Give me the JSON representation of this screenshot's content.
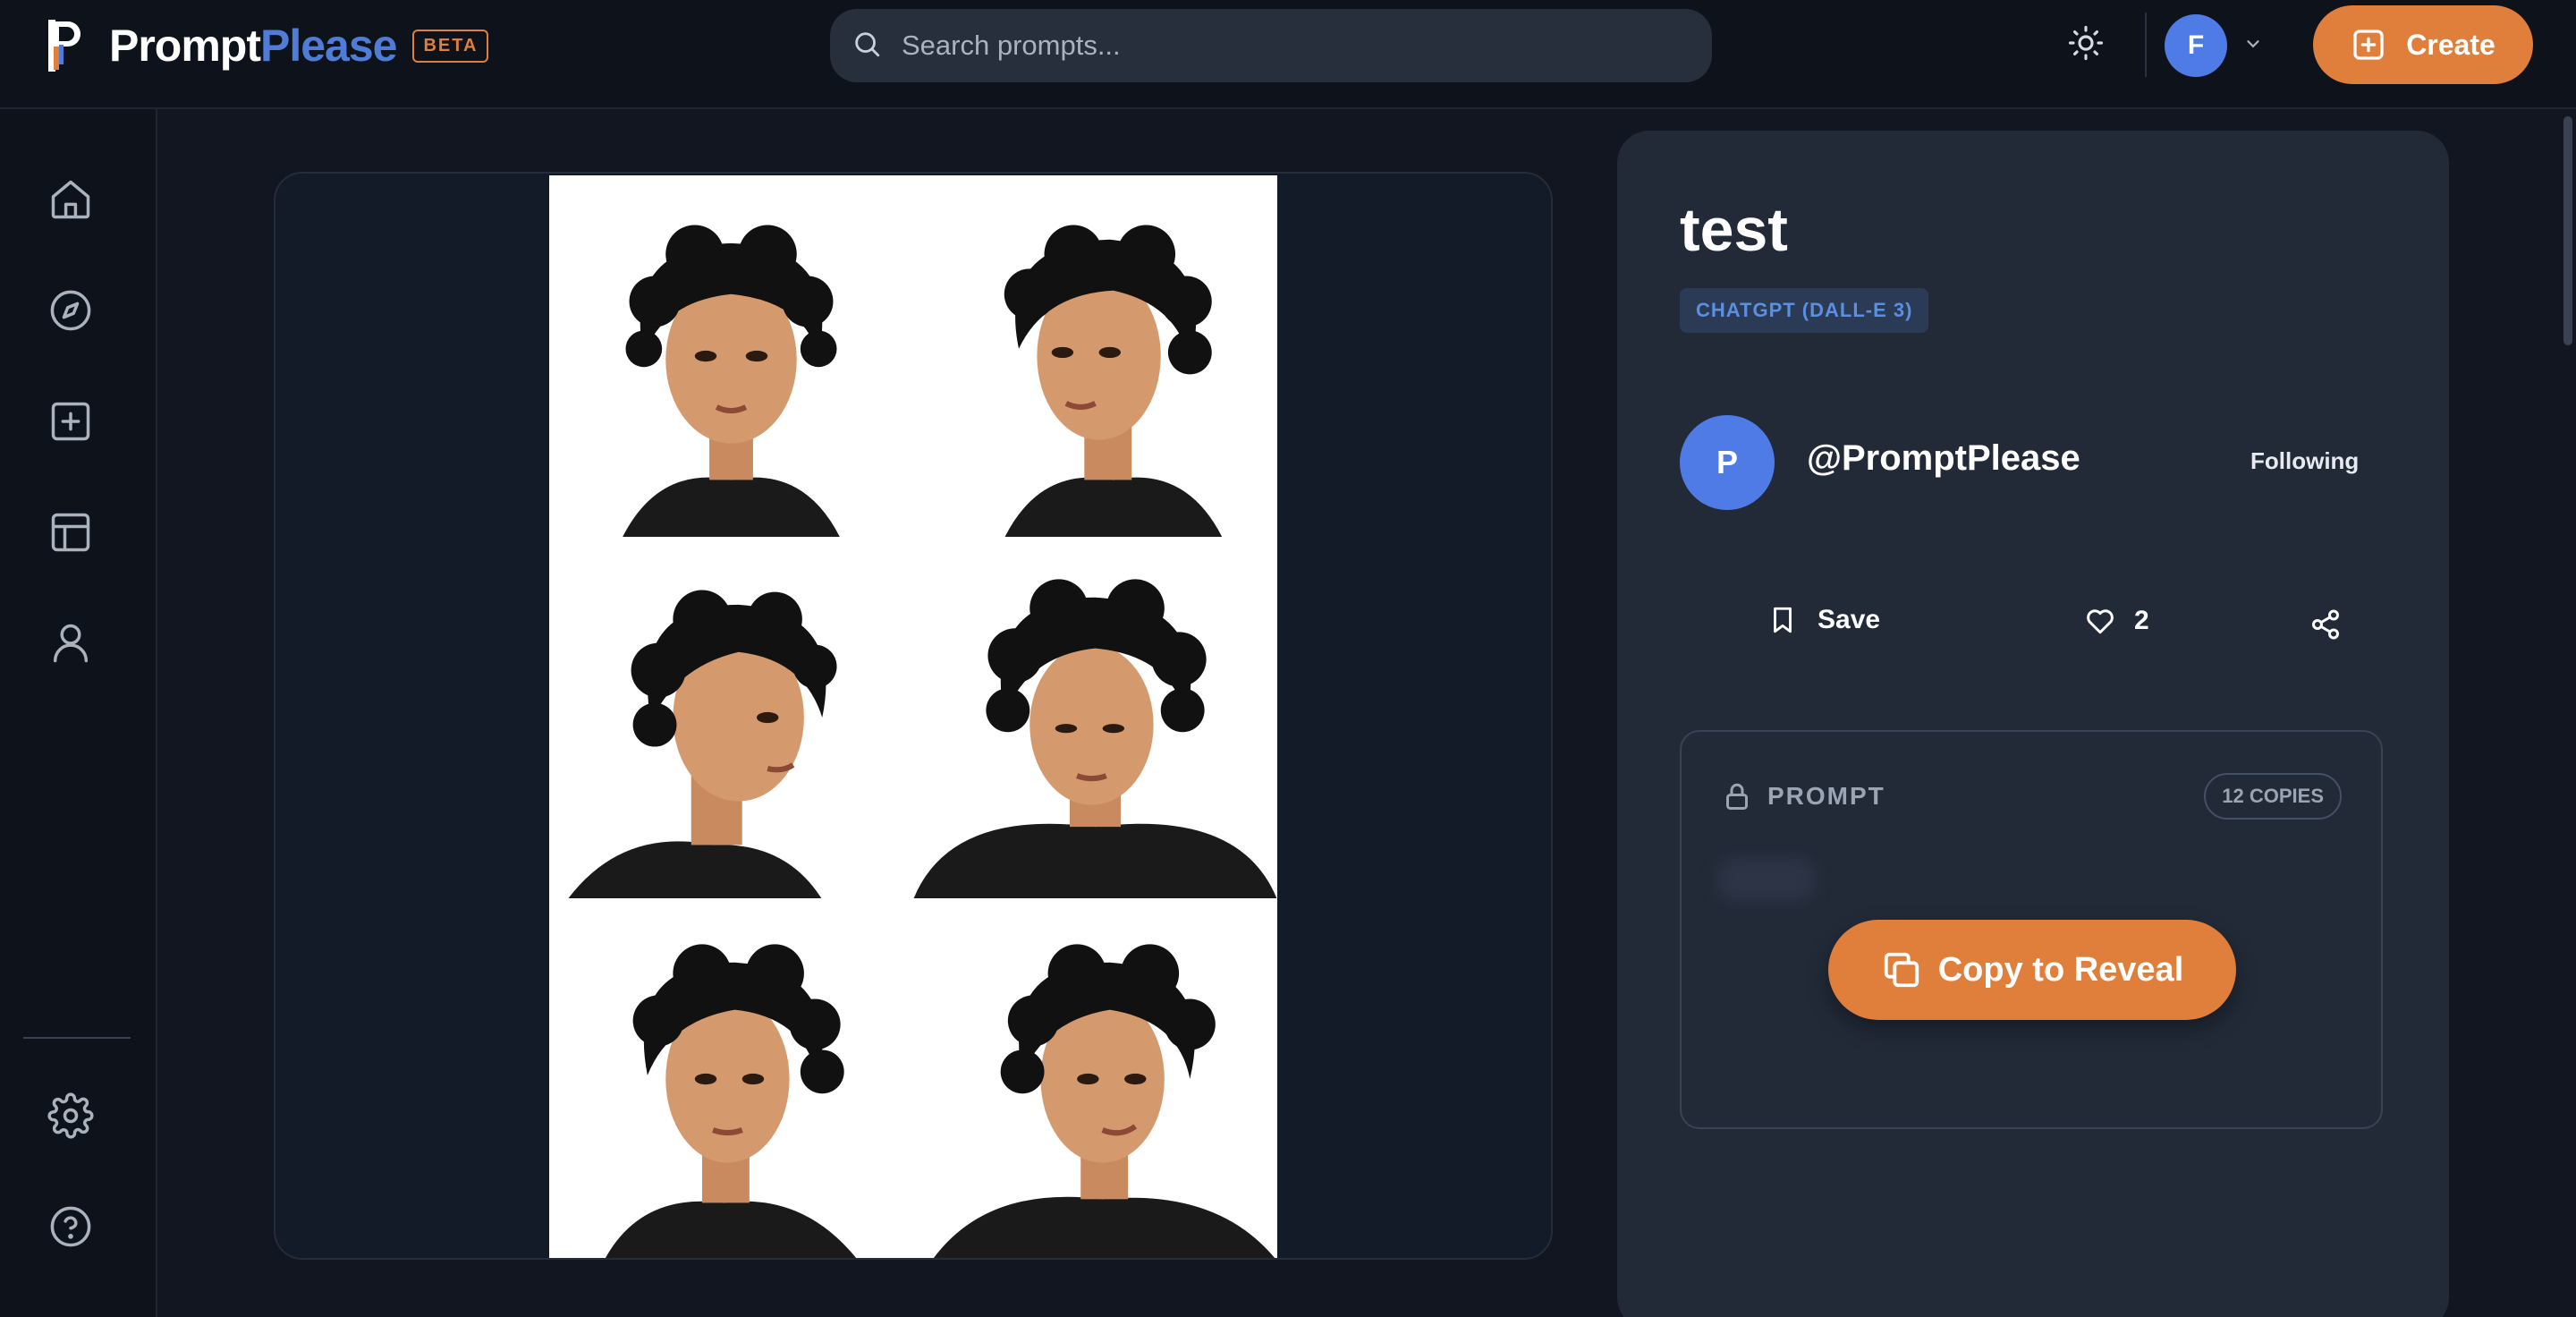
{
  "header": {
    "brand_part1": "Prompt",
    "brand_part2": "Please",
    "beta_label": "BETA",
    "search_placeholder": "Search prompts...",
    "user_initial": "F",
    "create_label": "Create"
  },
  "sidebar": {
    "items": [
      {
        "icon": "home-icon"
      },
      {
        "icon": "compass-icon"
      },
      {
        "icon": "plus-square-icon"
      },
      {
        "icon": "layout-icon"
      },
      {
        "icon": "user-icon"
      }
    ],
    "bottom": [
      {
        "icon": "gear-icon"
      },
      {
        "icon": "help-icon"
      }
    ]
  },
  "prompt": {
    "title": "test",
    "model": "CHATGPT (DALL-E 3)",
    "author_initial": "P",
    "author": "@PromptPlease",
    "follow_status": "Following",
    "save_label": "Save",
    "likes": "2",
    "section_label": "PROMPT",
    "copies": "12 COPIES",
    "reveal_label": "Copy to Reveal"
  },
  "colors": {
    "accent": "#e07f3b",
    "brand_blue": "#4f7cd6",
    "avatar_blue": "#4f7be6",
    "panel": "#222a38",
    "background": "#111620"
  }
}
